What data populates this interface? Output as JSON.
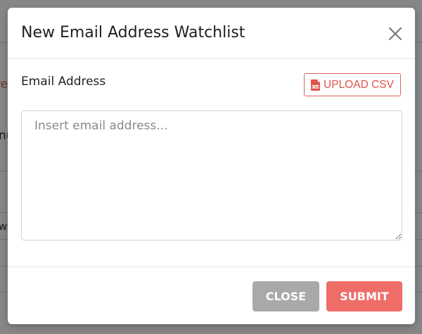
{
  "background": {
    "fragment_left_top": "re",
    "fragment_left_mid": "nu",
    "fragment_left_low": "w"
  },
  "modal": {
    "title": "New Email Address Watchlist",
    "close_icon": "close-icon"
  },
  "form": {
    "email_label": "Email Address",
    "upload_button_label": "UPLOAD CSV",
    "upload_icon": "csv-file-icon",
    "email_input_placeholder": "Insert email address...",
    "email_input_value": ""
  },
  "footer": {
    "close_label": "CLOSE",
    "submit_label": "SUBMIT"
  },
  "colors": {
    "accent": "#ee6d68",
    "accent_text": "#e0534d",
    "close_button": "#a9a9a9"
  }
}
